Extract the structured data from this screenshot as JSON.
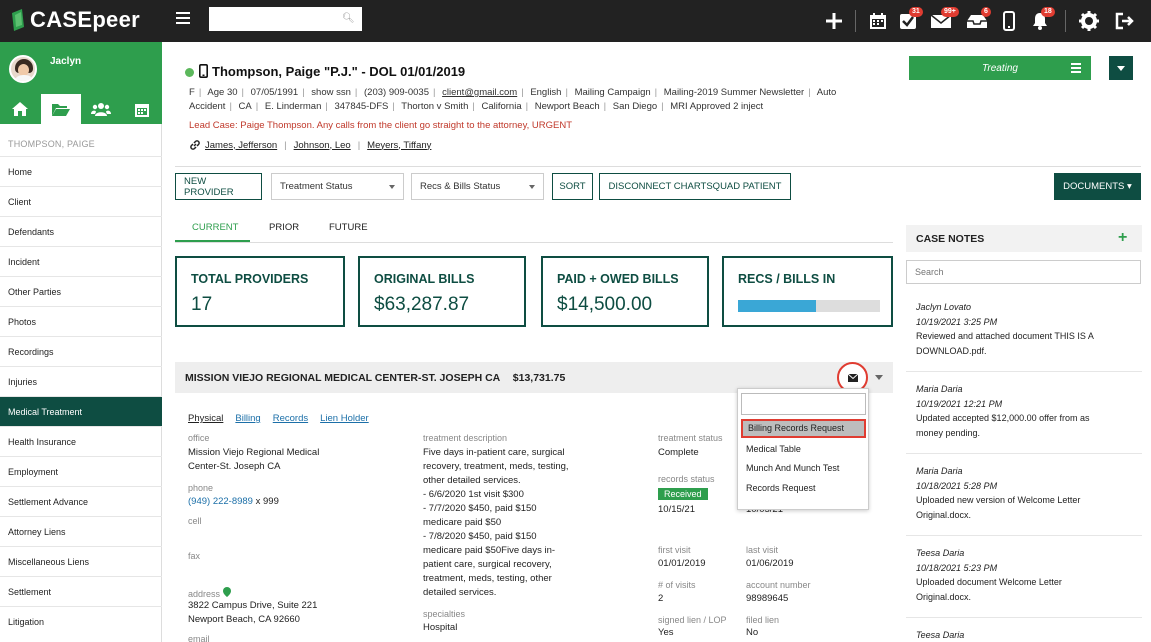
{
  "app": {
    "name": "CASEpeer"
  },
  "topbar": {
    "badges": {
      "tasks": "31",
      "mail": "99+",
      "inbox": "6",
      "notifications": "18"
    }
  },
  "sidebar": {
    "user_name": "Jaclyn",
    "case_label": "THOMPSON, PAIGE",
    "items": [
      "Home",
      "Client",
      "Defendants",
      "Incident",
      "Other Parties",
      "Photos",
      "Recordings",
      "Injuries",
      "Medical Treatment",
      "Health Insurance",
      "Employment",
      "Settlement Advance",
      "Attorney Liens",
      "Miscellaneous Liens",
      "Settlement",
      "Litigation"
    ],
    "active_item": "Medical Treatment"
  },
  "client": {
    "title": "Thompson, Paige \"P.J.\" - DOL 01/01/2019",
    "line1": [
      "F",
      "Age 30",
      "07/05/1991",
      "show ssn",
      "(203) 909-0035",
      "client@gmail.com",
      "English",
      "Mailing Campaign",
      "Mailing-2019 Summer Newsletter",
      "Auto"
    ],
    "line2": [
      "Accident",
      "CA",
      "E. Linderman",
      "347845-DFS",
      "Thorton v Smith",
      "California",
      "Newport Beach",
      "San Diego",
      "MRI Approved 2 inject"
    ],
    "lead_case": "Lead Case: Paige Thompson. Any calls from the client go straight to the attorney, URGENT",
    "people": [
      "James, Jefferson",
      "Johnson, Leo",
      "Meyers, Tiffany"
    ],
    "status": "Treating"
  },
  "toolbar": {
    "new_provider": "NEW PROVIDER",
    "treatment_status": "Treatment Status",
    "recs_bills_status": "Recs & Bills Status",
    "sort": "SORT",
    "disconnect": "DISCONNECT CHARTSQUAD PATIENT",
    "documents": "DOCUMENTS ▾"
  },
  "tabs": [
    "CURRENT",
    "PRIOR",
    "FUTURE"
  ],
  "stats": {
    "total_providers": {
      "label": "TOTAL PROVIDERS",
      "value": "17"
    },
    "original_bills": {
      "label": "ORIGINAL BILLS",
      "value": "$63,287.87"
    },
    "paid_owed": {
      "label": "PAID + OWED BILLS",
      "value": "$14,500.00"
    },
    "recs_bills_in": {
      "label": "RECS / BILLS IN",
      "progress": 0.55
    }
  },
  "provider": {
    "name": "MISSION VIEJO REGIONAL MEDICAL CENTER-ST. JOSEPH CA",
    "amount": "$13,731.75",
    "links": [
      "Physical",
      "Billing",
      "Records",
      "Lien Holder"
    ],
    "office_label": "office",
    "office_value_1": "Mission Viejo Regional Medical",
    "office_value_2": "Center-St. Joseph CA",
    "phone_label": "phone",
    "phone_number": "(949) 222-8989",
    "phone_ext": " x 999",
    "cell_label": "cell",
    "fax_label": "fax",
    "address_label": "address",
    "address_1": "3822 Campus Drive, Suite 221",
    "address_2": "Newport Beach, CA 92660",
    "email_label": "email",
    "treatment_desc_label": "treatment description",
    "treatment_desc_lines": [
      "Five days in-patient care, surgical",
      "recovery, treatment, meds, testing,",
      "other detailed services.",
      "- 6/6/2020 1st visit $300",
      "- 7/7/2020 $450, paid $150",
      "medicare paid $50",
      "- 7/8/2020 $450, paid $150",
      "medicare paid $50Five days in-",
      "patient care, surgical recovery,",
      "treatment, meds, testing, other",
      "detailed services."
    ],
    "specialties_label": "specialties",
    "specialties_value": "Hospital",
    "treatment_status_label": "treatment status",
    "treatment_status_value": "Complete",
    "records_status_label": "records status",
    "records_status_value": "Received",
    "records_date": "10/15/21",
    "records_date_2": "10/05/21",
    "first_visit_label": "first visit",
    "first_visit_value": "01/01/2019",
    "last_visit_label": "last visit",
    "last_visit_value": "01/06/2019",
    "visits_label": "# of visits",
    "visits_value": "2",
    "account_label": "account number",
    "account_value": "98989645",
    "signed_lien_label": "signed lien / LOP",
    "signed_lien_value": "Yes",
    "filed_lien_label": "filed lien",
    "filed_lien_value": "No"
  },
  "dropdown": {
    "items": [
      "Billing Records Request",
      "Medical Table",
      "Munch And Munch Test",
      "Records Request"
    ],
    "highlighted": "Billing Records Request"
  },
  "case_notes": {
    "title": "CASE NOTES",
    "search_placeholder": "Search",
    "notes": [
      {
        "who": "Jaclyn Lovato",
        "when": "10/19/2021 3:25 PM",
        "text_1": "Reviewed and attached document THIS IS A",
        "text_2": "DOWNLOAD.pdf."
      },
      {
        "who": "Maria Daria",
        "when": "10/19/2021 12:21 PM",
        "text_1": "Updated accepted $12,000.00 offer from as",
        "text_2": "money pending."
      },
      {
        "who": "Maria Daria",
        "when": "10/18/2021 5:28 PM",
        "text_1": "Uploaded new version of Welcome Letter",
        "text_2": "Original.docx."
      },
      {
        "who": "Teesa Daria",
        "when": "10/18/2021 5:23 PM",
        "text_1": "Uploaded document Welcome Letter",
        "text_2": "Original.docx."
      },
      {
        "who": "Teesa Daria",
        "when": "",
        "text_1": "",
        "text_2": ""
      }
    ]
  },
  "colors": {
    "brand_green": "#2e9e4d",
    "dark_green": "#0e4d42",
    "alert_red": "#e03c31",
    "link_blue": "#1b6fa8",
    "progress_blue": "#3aa7d6"
  }
}
